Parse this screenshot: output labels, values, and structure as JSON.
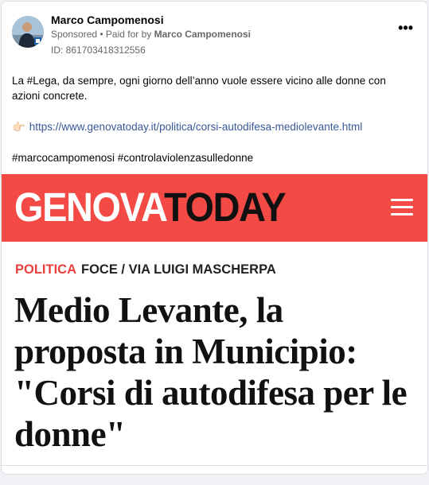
{
  "post": {
    "author": "Marco Campomenosi",
    "sponsored": "Sponsored",
    "paid_prefix": " • Paid for by ",
    "paid_by": "Marco Campomenosi",
    "ad_id": "ID: 861703418312556",
    "more_label": "•••",
    "text_line1": "La #Lega, da sempre, ogni giorno dell’anno vuole essere vicino alle donne con azioni concrete.",
    "pointing_emoji": "👉🏻",
    "link": "https://www.genovatoday.it/politica/corsi-autodifesa-mediolevante.html",
    "hashtags": "#marcocampomenosi #controlaviolenzasulledonne"
  },
  "preview": {
    "logo_part1": "GENOVA",
    "logo_part2": "TODAY",
    "section": "POLITICA",
    "location": "FOCE / VIA LUIGI MASCHERPA",
    "headline": "Medio Levante, la proposta in Municipio: \"Corsi di autodifesa per le donne\""
  },
  "colors": {
    "brand_red": "#f44a46",
    "link_blue": "#385898",
    "meta_gray": "#65676b"
  },
  "icons": [
    "menu-icon",
    "more-options-icon",
    "avatar"
  ]
}
